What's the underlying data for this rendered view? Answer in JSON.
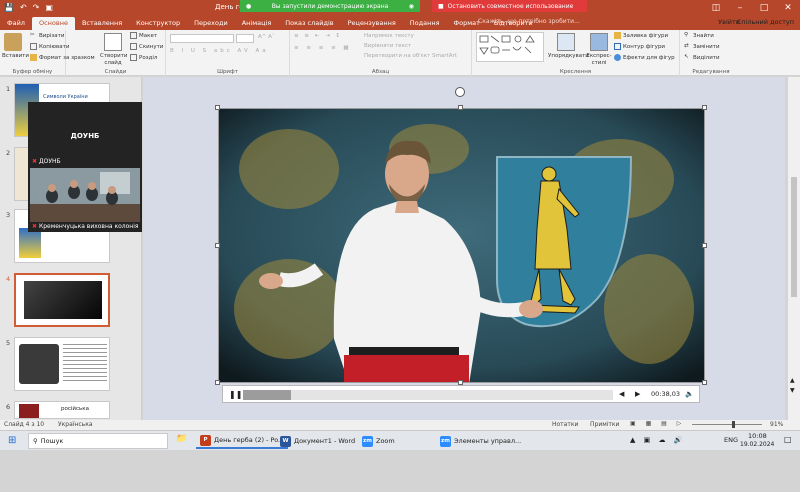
{
  "titlebar": {
    "doc_title": "День герба",
    "share_text": "Вы запустили демонстрацию экрана",
    "stop_text": "Остановить совместное использование"
  },
  "tabs": [
    "Файл",
    "Основне",
    "Вставлення",
    "Конструктор",
    "Переходи",
    "Анімація",
    "Показ слайдів",
    "Рецензування",
    "Подання",
    "Формат",
    "Відтворити"
  ],
  "tell_me": "Скажіть, що потрібно зробити...",
  "sign_in": "Увійти",
  "share": "Спільний доступ",
  "ribbon": {
    "paste": "Вставити",
    "cut": "Вирізати",
    "copy": "Копіювати",
    "format_painter": "Формат за зразком",
    "clipboard": "Буфер обміну",
    "new_slide": "Створити слайд",
    "layout": "Макет",
    "reset": "Скинути",
    "section": "Розділ",
    "slides": "Слайди",
    "font": "Шрифт",
    "text_direction": "Напрямок тексту",
    "align_text": "Вирівняти текст",
    "convert_smartart": "Перетворити на об'єкт SmartArt",
    "paragraph": "Абзац",
    "arrange": "Упорядкувати",
    "quick_styles": "Експрес-стилі",
    "shape_fill": "Заливка фігури",
    "shape_outline": "Контур фігури",
    "shape_effects": "Ефекти для фігур",
    "drawing": "Креслення",
    "find": "Знайти",
    "replace": "Замінити",
    "select": "Виділити",
    "editing": "Редагування"
  },
  "slides": [
    {
      "num": "1",
      "caption": "Символи України"
    },
    {
      "num": "2",
      "caption": ""
    },
    {
      "num": "3",
      "caption": ""
    },
    {
      "num": "4",
      "caption": ""
    },
    {
      "num": "5",
      "caption": ""
    },
    {
      "num": "6",
      "caption": "російська"
    }
  ],
  "zoom_popup": {
    "name": "ДОУНБ",
    "sub": "ДОУНБ",
    "caption": "Кременчуцька виховна колонія"
  },
  "player": {
    "time": "00:38,03",
    "progress": 0.13
  },
  "status": {
    "slide_of": "Слайд 4 з 10",
    "lang": "Українська",
    "notes": "Нотатки",
    "comments": "Примітки",
    "zoom": "91%"
  },
  "taskbar": {
    "search": "Пошук",
    "items": [
      "День герба (2) - Po...",
      "Документ1 - Word",
      "Zoom",
      "Элементы управл..."
    ],
    "lang": "ENG",
    "time": "10:08",
    "date": "19.02.2024"
  },
  "colors": {
    "accent": "#b7472a",
    "share_green": "#3cb043",
    "stop_red": "#e03a3a"
  }
}
